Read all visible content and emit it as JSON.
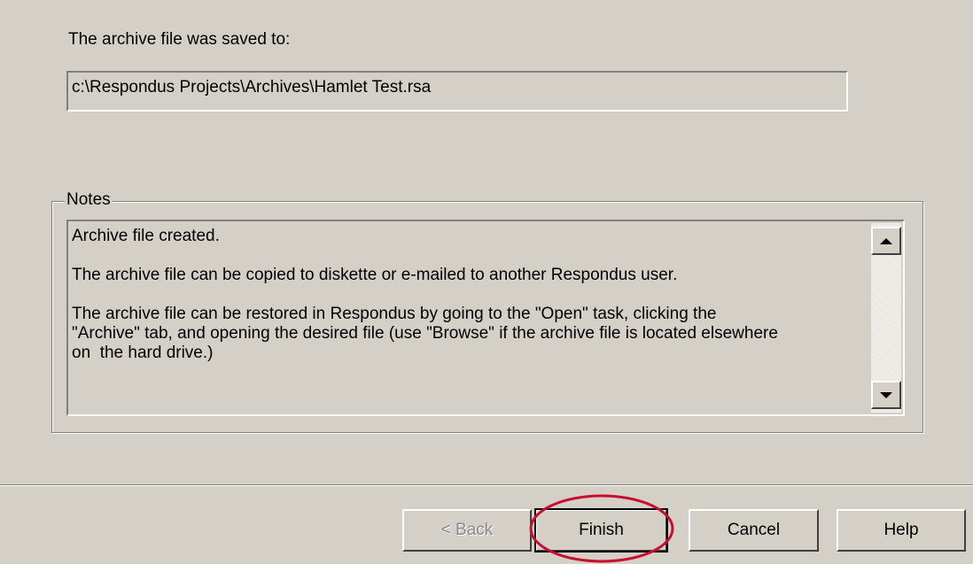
{
  "saved": {
    "label": "The archive file was saved to:",
    "path": "c:\\Respondus Projects\\Archives\\Hamlet Test.rsa"
  },
  "notes": {
    "legend": "Notes",
    "text": "Archive file created.\n\nThe archive file can be copied to diskette or e-mailed to another Respondus user.\n\nThe archive file can be restored in Respondus by going to the \"Open\" task, clicking the\n\"Archive\" tab, and opening the desired file (use \"Browse\" if the archive file is located elsewhere\non  the hard drive.)"
  },
  "buttons": {
    "back": "< Back",
    "finish": "Finish",
    "cancel": "Cancel",
    "help": "Help"
  },
  "colors": {
    "dialog_bg": "#d4d0c8",
    "highlight": "#c8102e"
  }
}
